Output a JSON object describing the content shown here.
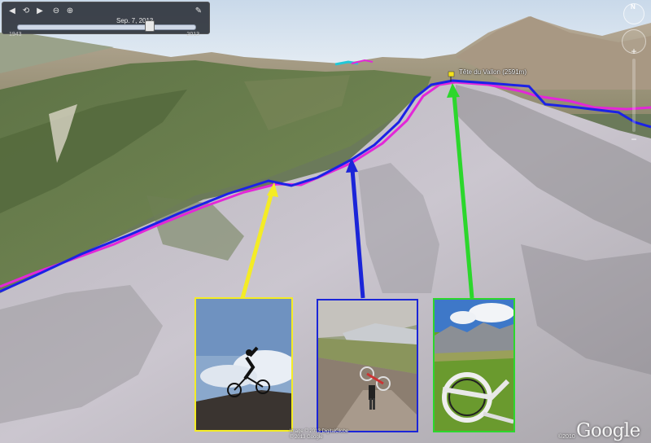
{
  "time_slider": {
    "buttons": [
      "prev-icon",
      "settings-icon",
      "next-icon",
      "zoom-out-icon",
      "zoom-in-icon",
      "wrench-icon"
    ],
    "current_date": "Sep. 7, 2013",
    "start_year": "1943",
    "end_year": "2013",
    "position": 0.74
  },
  "navigation": {
    "north_label": "N"
  },
  "map": {
    "peak_label": "Tête du Vallon (2591m)",
    "track_colors": {
      "route_a": "#1b22e6",
      "route_b": "#e327d8"
    },
    "arrow_colors": {
      "yellow": "#f4ec25",
      "blue": "#1b25d8",
      "green": "#2cd72c"
    }
  },
  "photos": [
    {
      "id": "yellow",
      "subject": "rider on ridge against sky"
    },
    {
      "id": "blue",
      "subject": "rider carrying bike up trail"
    },
    {
      "id": "green",
      "subject": "bike lying on alpine meadow"
    }
  ],
  "attribution": {
    "image_credit": "Image © 2013 DigitalGlobe",
    "data_credit": "© 2013 Google",
    "copyright_year": "©2010",
    "logo": "Google"
  }
}
